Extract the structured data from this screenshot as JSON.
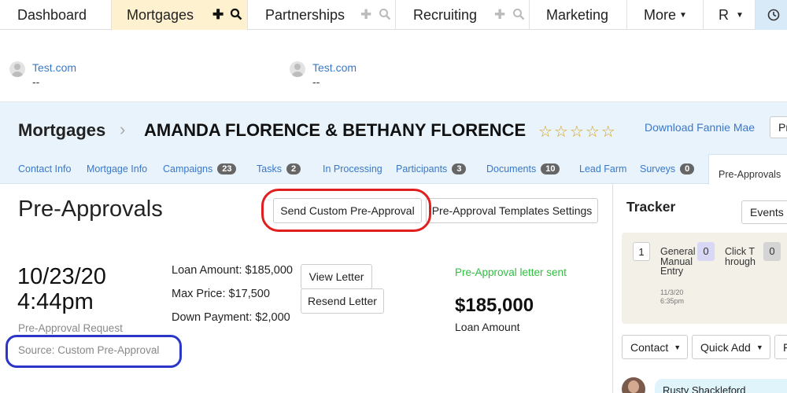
{
  "nav": {
    "tabs": [
      {
        "label": "Dashboard"
      },
      {
        "label": "Mortgages"
      },
      {
        "label": "Partnerships"
      },
      {
        "label": "Recruiting"
      },
      {
        "label": "Marketing"
      },
      {
        "label": "More"
      },
      {
        "label": "R"
      }
    ],
    "add_icon": "plus-icon",
    "search_icon": "search-icon",
    "clock_icon": "clock-icon"
  },
  "contacts": [
    {
      "name": "Test.com",
      "detail": "--"
    },
    {
      "name": "Test.com",
      "detail": "--"
    }
  ],
  "header": {
    "section": "Mortgages",
    "record_name": "AMANDA FLORENCE & BETHANY FLORENCE",
    "rating_stars": 0,
    "rating_max": 5,
    "download_link": "Download Fannie Mae",
    "pr_button": "Pr"
  },
  "subtabs": [
    {
      "label": "Contact Info"
    },
    {
      "label": "Mortgage Info"
    },
    {
      "label": "Campaigns",
      "count": "23"
    },
    {
      "label": "Tasks",
      "count": "2"
    },
    {
      "label": "In Processing"
    },
    {
      "label": "Participants",
      "count": "3"
    },
    {
      "label": "Documents",
      "count": "10"
    },
    {
      "label": "Lead Farm"
    },
    {
      "label": "Surveys",
      "count": "0"
    },
    {
      "label": "Pre-Approvals"
    }
  ],
  "main": {
    "title": "Pre-Approvals",
    "send_button": "Send Custom Pre-Approval",
    "templates_button": "Pre-Approval Templates Settings",
    "entry": {
      "date": "10/23/20",
      "time": "4:44pm",
      "type": "Pre-Approval Request",
      "source": "Source: Custom Pre-Approval",
      "loan_amount": "Loan Amount: $185,000",
      "max_price": "Max Price: $17,500",
      "down_payment": "Down Payment: $2,000",
      "view_button": "View Letter",
      "resend_button": "Resend Letter",
      "status": "Pre-Approval letter sent",
      "amount": "$185,000",
      "amount_label": "Loan Amount"
    }
  },
  "tracker": {
    "title": "Tracker",
    "events_button": "Events",
    "items": [
      {
        "count": "1",
        "label": "General Manual Entry",
        "time": "11/3/20 6:35pm"
      },
      {
        "count": "0",
        "label": "Click Through"
      },
      {
        "count": "0"
      }
    ],
    "contact_dropdown": "Contact",
    "quick_add_dropdown": "Quick Add",
    "partial_dropdown": "F",
    "chip_name": "Rusty Shackleford"
  },
  "colors": {
    "accent_link": "#3a78c9",
    "active_tab_bg": "#fdf1cf",
    "header_band": "#e8f3fc",
    "status_green": "#2fbf3f",
    "star": "#d9a017",
    "annotation_red": "#e02020",
    "annotation_blue": "#2b35c8"
  }
}
